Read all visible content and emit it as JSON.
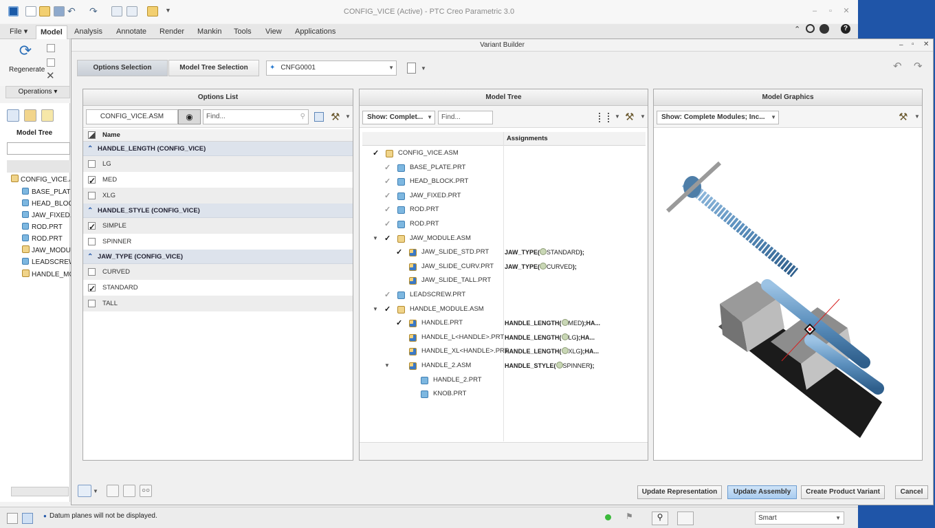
{
  "window": {
    "title": "CONFIG_VICE (Active) - PTC Creo Parametric 3.0"
  },
  "ribbon": {
    "tabs": [
      "File ▾",
      "Model",
      "Analysis",
      "Annotate",
      "Render",
      "Mankin",
      "Tools",
      "View",
      "Applications"
    ],
    "regenerate_label": "Regenerate",
    "operations_label": "Operations ▾"
  },
  "left_tree": {
    "title": "Model Tree",
    "items": [
      {
        "label": "CONFIG_VICE.ASM",
        "type": "asm"
      },
      {
        "label": "BASE_PLATE.PRT",
        "type": "prt"
      },
      {
        "label": "HEAD_BLOCK.PRT",
        "type": "prt"
      },
      {
        "label": "JAW_FIXED.PRT",
        "type": "prt"
      },
      {
        "label": "ROD.PRT",
        "type": "prt"
      },
      {
        "label": "ROD.PRT",
        "type": "prt"
      },
      {
        "label": "JAW_MODULE.ASM",
        "type": "asm"
      },
      {
        "label": "LEADSCREW.PRT",
        "type": "prt"
      },
      {
        "label": "HANDLE_MODULE.ASM",
        "type": "asm"
      }
    ]
  },
  "dialog": {
    "title": "Variant Builder",
    "seg_options": "Options Selection",
    "seg_tree": "Model Tree Selection",
    "variant_name": "CNFG0001",
    "options_panel": {
      "title": "Options List",
      "asm_name": "CONFIG_VICE.ASM",
      "find_placeholder": "Find...",
      "col_name": "Name",
      "groups": [
        {
          "label": "HANDLE_LENGTH (CONFIG_VICE)",
          "options": [
            {
              "label": "LG",
              "checked": false
            },
            {
              "label": "MED",
              "checked": true
            },
            {
              "label": "XLG",
              "checked": false
            }
          ]
        },
        {
          "label": "HANDLE_STYLE (CONFIG_VICE)",
          "options": [
            {
              "label": "SIMPLE",
              "checked": true
            },
            {
              "label": "SPINNER",
              "checked": false
            }
          ]
        },
        {
          "label": "JAW_TYPE (CONFIG_VICE)",
          "options": [
            {
              "label": "CURVED",
              "checked": false
            },
            {
              "label": "STANDARD",
              "checked": true
            },
            {
              "label": "TALL",
              "checked": false
            }
          ]
        }
      ]
    },
    "tree_panel": {
      "title": "Model Tree",
      "show_label": "Show: Complet...",
      "find_placeholder": "Find...",
      "col_assign": "Assignments",
      "rows": [
        {
          "label": "CONFIG_VICE.ASM",
          "level": 0,
          "check": "dark",
          "icon": "asm",
          "expand": "",
          "assign": "",
          "assign_opt": "",
          "assign_rest": ""
        },
        {
          "label": "BASE_PLATE.PRT",
          "level": 1,
          "check": "light",
          "icon": "prt",
          "expand": "",
          "assign": "",
          "assign_opt": "",
          "assign_rest": ""
        },
        {
          "label": "HEAD_BLOCK.PRT",
          "level": 1,
          "check": "light",
          "icon": "prt",
          "expand": "",
          "assign": "",
          "assign_opt": "",
          "assign_rest": ""
        },
        {
          "label": "JAW_FIXED.PRT",
          "level": 1,
          "check": "light",
          "icon": "prt",
          "expand": "",
          "assign": "",
          "assign_opt": "",
          "assign_rest": ""
        },
        {
          "label": "ROD.PRT",
          "level": 1,
          "check": "light",
          "icon": "prt",
          "expand": "",
          "assign": "",
          "assign_opt": "",
          "assign_rest": ""
        },
        {
          "label": "ROD.PRT",
          "level": 1,
          "check": "light",
          "icon": "prt",
          "expand": "",
          "assign": "",
          "assign_opt": "",
          "assign_rest": ""
        },
        {
          "label": "JAW_MODULE.ASM",
          "level": 1,
          "check": "dark",
          "icon": "asm",
          "expand": "▼",
          "assign": "",
          "assign_opt": "",
          "assign_rest": ""
        },
        {
          "label": "JAW_SLIDE_STD.PRT",
          "level": 2,
          "check": "dark",
          "icon": "var",
          "expand": "",
          "assign": "JAW_TYPE(",
          "assign_opt": "STANDARD",
          "assign_rest": ");"
        },
        {
          "label": "JAW_SLIDE_CURV.PRT",
          "level": 2,
          "check": "",
          "icon": "var",
          "expand": "",
          "assign": "JAW_TYPE(",
          "assign_opt": "CURVED",
          "assign_rest": ");"
        },
        {
          "label": "JAW_SLIDE_TALL.PRT",
          "level": 2,
          "check": "",
          "icon": "var",
          "expand": "",
          "assign": "",
          "assign_opt": "",
          "assign_rest": ""
        },
        {
          "label": "LEADSCREW.PRT",
          "level": 1,
          "check": "light",
          "icon": "prt",
          "expand": "",
          "assign": "",
          "assign_opt": "",
          "assign_rest": ""
        },
        {
          "label": "HANDLE_MODULE.ASM",
          "level": 1,
          "check": "dark",
          "icon": "asm",
          "expand": "▼",
          "assign": "",
          "assign_opt": "",
          "assign_rest": ""
        },
        {
          "label": "HANDLE.PRT",
          "level": 2,
          "check": "dark",
          "icon": "var",
          "expand": "",
          "assign": "HANDLE_LENGTH(",
          "assign_opt": "MED",
          "assign_rest": ");HA..."
        },
        {
          "label": "HANDLE_L<HANDLE>.PRT",
          "level": 2,
          "check": "",
          "icon": "var",
          "expand": "",
          "assign": "HANDLE_LENGTH(",
          "assign_opt": "LG",
          "assign_rest": ");HA..."
        },
        {
          "label": "HANDLE_XL<HANDLE>.PRT",
          "level": 2,
          "check": "",
          "icon": "var",
          "expand": "",
          "assign": "HANDLE_LENGTH(",
          "assign_opt": "XLG",
          "assign_rest": ");HA..."
        },
        {
          "label": "HANDLE_2.ASM",
          "level": 2,
          "check": "",
          "icon": "var",
          "expand": "▼",
          "assign": "HANDLE_STYLE(",
          "assign_opt": "SPINNER",
          "assign_rest": ");"
        },
        {
          "label": "HANDLE_2.PRT",
          "level": 3,
          "check": "",
          "icon": "prt",
          "expand": "",
          "assign": "",
          "assign_opt": "",
          "assign_rest": ""
        },
        {
          "label": "KNOB.PRT",
          "level": 3,
          "check": "",
          "icon": "prt",
          "expand": "",
          "assign": "",
          "assign_opt": "",
          "assign_rest": ""
        }
      ]
    },
    "graphics_panel": {
      "title": "Model Graphics",
      "show_label": "Show: Complete Modules; Inc..."
    },
    "buttons": {
      "update_rep": "Update Representation",
      "update_asm": "Update Assembly",
      "create_variant": "Create Product Variant",
      "cancel": "Cancel"
    }
  },
  "status": {
    "message": "Datum planes will not be displayed.",
    "filter": "Smart"
  }
}
